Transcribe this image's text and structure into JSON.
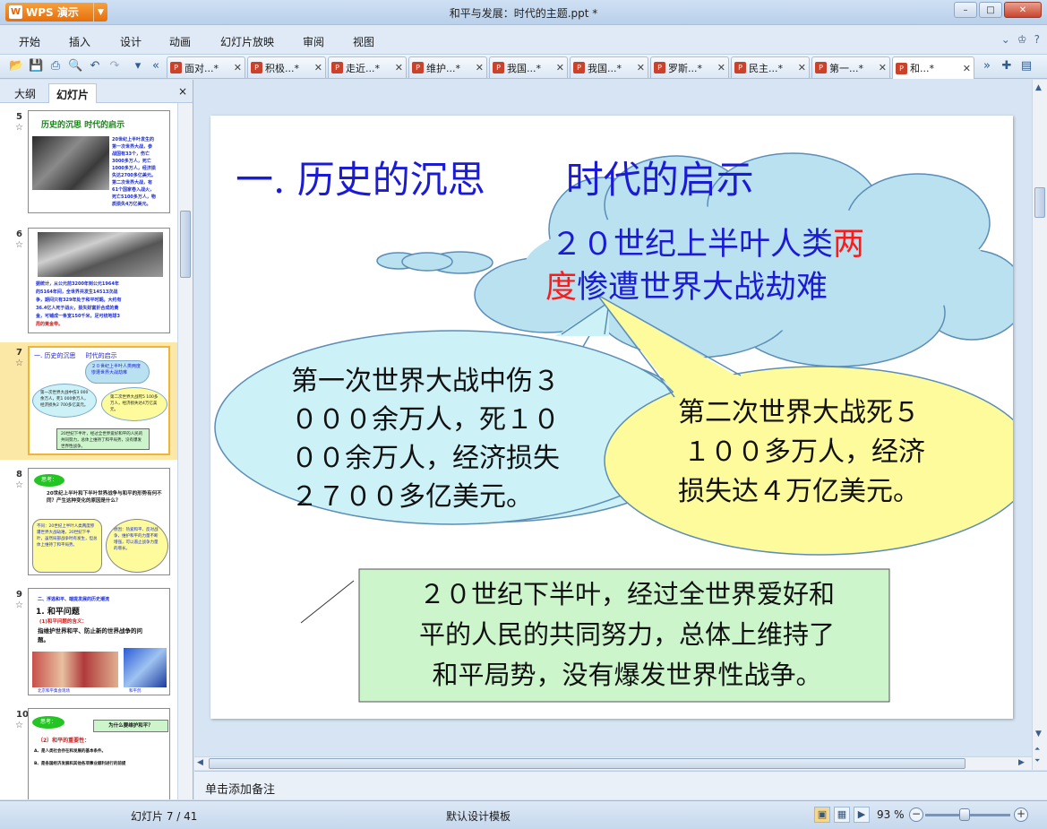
{
  "app": {
    "logo_text": "WPS 演示",
    "logo_badge": "W",
    "window_title": "和平与发展：时代的主题.ppt *"
  },
  "window_buttons": [
    "–",
    "□",
    "✕"
  ],
  "menu": [
    "开始",
    "插入",
    "设计",
    "动画",
    "幻灯片放映",
    "审阅",
    "视图"
  ],
  "menu_right_icons": [
    "⌄",
    "♔",
    "?"
  ],
  "doc_tabs": [
    {
      "label": "面对...*"
    },
    {
      "label": "积极...*"
    },
    {
      "label": "走近...*"
    },
    {
      "label": "维护...*"
    },
    {
      "label": "我国...*"
    },
    {
      "label": "我国...*"
    },
    {
      "label": "罗斯...*"
    },
    {
      "label": "民主...*"
    },
    {
      "label": "第一...*"
    },
    {
      "label": "和...*"
    }
  ],
  "panel": {
    "tab_outline": "大纲",
    "tab_slides": "幻灯片",
    "close": "×"
  },
  "thumbnails": [
    {
      "num": "5",
      "title": "历史的沉思  时代的启示",
      "lines": [
        "20世纪上半叶发生的",
        "第一次世界大战，参",
        "战国有33个，伤亡",
        "3000多万人，死亡",
        "1000多万人，经济损",
        "失达2700多亿美元。",
        "第二次世界大战，有",
        "61个国家卷入战火，",
        "死亡5100多万人，物",
        "质损失4万亿美元。"
      ]
    },
    {
      "num": "6",
      "lines": [
        "据统计，从公元前3200年到公元1964年",
        "的5164年间，全世界共发生14513次战",
        "争，期间只有329年处于和平时期。大约有",
        "36.4亿人死于战火，损失财富折合成的黄",
        "金，可铺成一条宽150千米，足可绕地球3",
        "周的黄金带。"
      ]
    },
    {
      "num": "7",
      "title": "一. 历史的沉思     时代的启示",
      "cloud": "２０世纪上半叶人类两度惨遭世界大战劫难",
      "left": "第一次世界大战中伤3 000余万人，死1 000余万人，经济损失2 700多亿美元。",
      "right": "第二次世界大战死5 100多万人，经济损失达4万亿美元。",
      "box": "20世纪下半叶，经过全世界爱好和平的人民的共同努力，总体上维持了和平局势，没有爆发世界性战争。"
    },
    {
      "num": "8",
      "tag": "思考：",
      "question": "20世纪上半叶和下半叶世界战争与和平的形势有何不同？产生这种变化的原因是什么？",
      "left": "不同：20世纪上半叶人类两度惨遭世界大战劫难，20世纪下半叶，虽然局部战争时有发生，但总体上维持了和平局势。",
      "right": "原因：热爱和平、反对战争，维护和平的力量不断增强，可以遏止战争力量的增长。"
    },
    {
      "num": "9",
      "section": "二、浮逃和平、端提发展的历史潮流",
      "heading": "1. 和平问题",
      "sub": "(1)和平问题的含义：",
      "body": "指维护世界和平、防止新的世界战争的问题。",
      "caption1": "北京和平集会现场",
      "caption2": "和平鸽"
    },
    {
      "num": "10",
      "tag": "思考：",
      "question": "为什么要维护和平？",
      "sub": "（2）和平的重要性：",
      "items": [
        "A、是人类社会存在和发展的基本条件。",
        "B、是各国经济发展和其他各项事业顺利进行的前提"
      ]
    }
  ],
  "slide": {
    "title_part1": "一. 历史的沉思",
    "title_part2": "时代的启示",
    "cloud_line1_a": "２０世纪上半叶人类",
    "cloud_line1_b": "两",
    "cloud_line2_a": "度",
    "cloud_line2_b": "惨遭世界大战劫难",
    "left_bubble": [
      "第一次世界大战中伤３",
      "０００余万人，死１０",
      "００余万人，经济损失",
      "２７００多亿美元。"
    ],
    "right_bubble": [
      "第二次世界大战死５",
      "１００多万人，经济",
      "损失达４万亿美元。"
    ],
    "bottom_box": [
      "２０世纪下半叶，经过全世界爱好和",
      "平的人民的共同努力，总体上维持了",
      "和平局势，没有爆发世界性战争。"
    ],
    "colors": {
      "title_blue": "#1b1bd6",
      "cloud_fill": "#b9e1f0",
      "left_fill": "#ccf1f6",
      "right_fill": "#fdfb9c",
      "box_fill": "#ccf5cc",
      "accent_red": "#ff1a1a"
    }
  },
  "notes_placeholder": "单击添加备注",
  "status": {
    "slide_counter": "幻灯片 7 / 41",
    "template": "默认设计模板",
    "zoom": "93 %",
    "zoom_level": 0.41
  }
}
